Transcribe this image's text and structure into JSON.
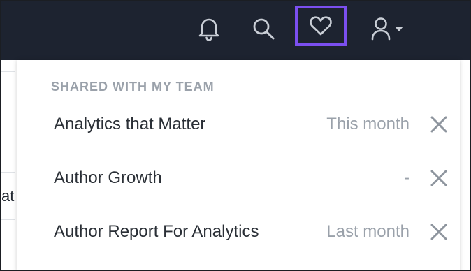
{
  "topbar": {
    "icons": [
      "bell-icon",
      "search-icon",
      "heart-icon",
      "user-icon",
      "caret-down-icon"
    ],
    "favorites_highlight_color": "#7b4ff0",
    "background_color": "#1d2330"
  },
  "background_page": {
    "fragment_text": "at"
  },
  "dropdown": {
    "section_title": "SHARED WITH MY TEAM",
    "items": [
      {
        "name": "Analytics that Matter",
        "meta": "This month"
      },
      {
        "name": "Author Growth",
        "meta": "-"
      },
      {
        "name": "Author Report For Analytics",
        "meta": "Last month"
      }
    ]
  }
}
